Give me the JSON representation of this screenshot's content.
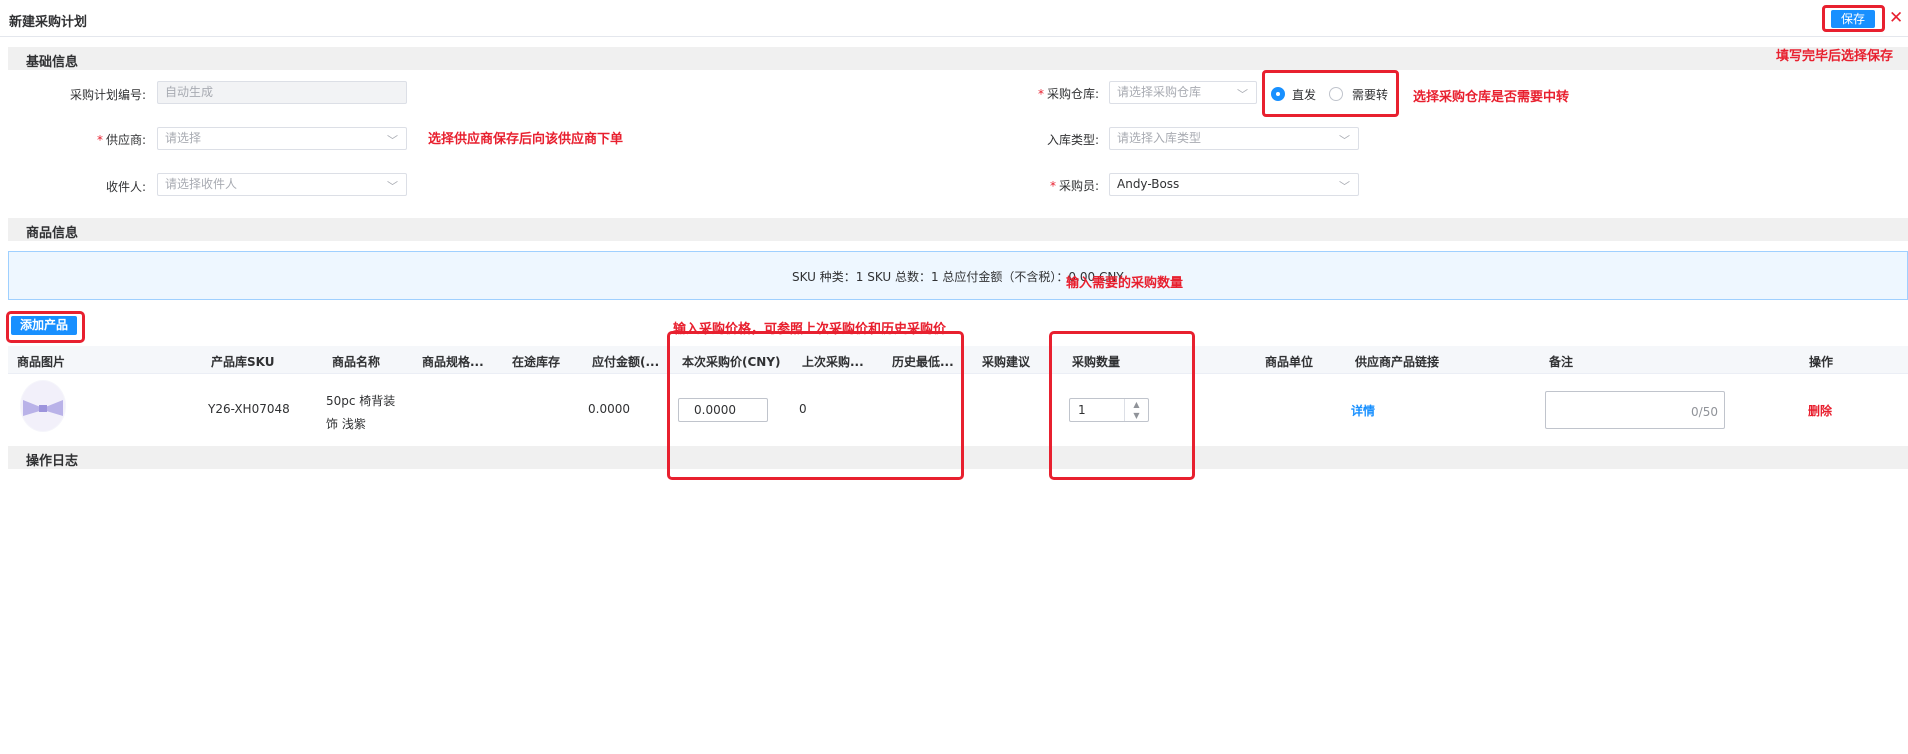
{
  "header": {
    "title": "新建采购计划",
    "save_label": "保存",
    "close_glyph": "✕"
  },
  "sections": {
    "basic": "基础信息",
    "goods": "商品信息",
    "log": "操作日志"
  },
  "annotations": {
    "save": "填写完毕后选择保存",
    "warehouse": "选择采购仓库是否需要中转",
    "supplier": "选择供应商保存后向该供应商下单",
    "quantity": "输入需要的采购数量",
    "price": "输入采购价格，可参照上次采购价和历史采购价"
  },
  "form": {
    "plan_no": {
      "label": "采购计划编号:",
      "placeholder": "自动生成"
    },
    "supplier": {
      "required": "*",
      "label": "供应商:",
      "placeholder": "请选择"
    },
    "receiver": {
      "label": "收件人:",
      "placeholder": "请选择收件人"
    },
    "warehouse": {
      "required": "*",
      "label": "采购仓库:",
      "placeholder": "请选择采购仓库"
    },
    "inbound_type": {
      "label": "入库类型:",
      "placeholder": "请选择入库类型"
    },
    "buyer": {
      "required": "*",
      "label": "采购员:",
      "value": "Andy-Boss"
    },
    "shipping": {
      "options": [
        "直发",
        "需要转"
      ],
      "selected": "直发"
    }
  },
  "summary": {
    "text": "SKU 种类：1 SKU 总数：1 总应付金额（不含税）：0.00 CNY"
  },
  "add_product_label": "添加产品",
  "table": {
    "columns": [
      "商品图片",
      "产品库SKU",
      "商品名称",
      "商品规格...",
      "在途库存",
      "应付金额(...",
      "本次采购价(CNY)",
      "上次采购...",
      "历史最低...",
      "采购建议",
      "采购数量",
      "商品单位",
      "供应商产品链接",
      "备注",
      "操作"
    ],
    "rows": [
      {
        "sku": "Y26-XH07048",
        "name_line1": "50pc 椅背装",
        "name_line2": "饰 浅紫",
        "amount": "0.0000",
        "price": "0.0000",
        "last_price": "0",
        "qty": "1",
        "link": "详情",
        "remark_count": "0/50",
        "action": "删除"
      }
    ]
  },
  "icons": {
    "close": "close-icon",
    "chevron": "chevron-down-icon",
    "spin_up": "caret-up-icon",
    "spin_down": "caret-down-icon"
  },
  "colors": {
    "primary": "#1890ff",
    "annotation": "#e8202f",
    "section_bg": "#f0f0f0",
    "summary_bg": "#eef7ff"
  }
}
